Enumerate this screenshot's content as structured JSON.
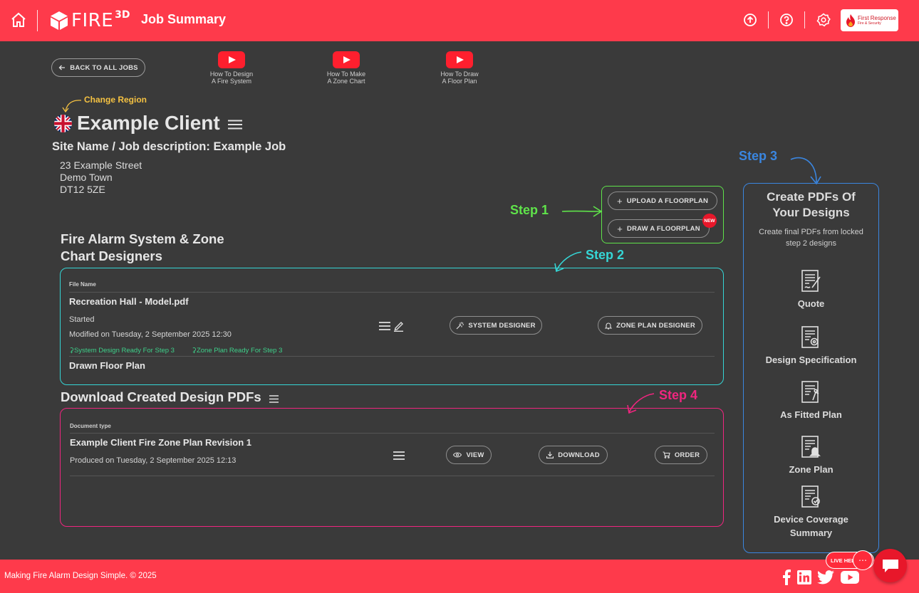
{
  "header": {
    "logo_text": "FIRE",
    "logo_sup": "3D",
    "title": "Job Summary",
    "brand_name": "First Response",
    "brand_sub": "Fire & Security"
  },
  "nav": {
    "back_label": "BACK TO ALL JOBS",
    "videos": [
      {
        "line1": "How To Design",
        "line2": "A Fire System"
      },
      {
        "line1": "How To Make",
        "line2": "A Zone Chart"
      },
      {
        "line1": "How To Draw",
        "line2": "A Floor Plan"
      }
    ]
  },
  "client": {
    "change_region": "Change Region",
    "name": "Example Client",
    "site_name": "Site Name / Job description: Example Job",
    "address": [
      "23 Example Street",
      "Demo Town",
      "DT12 5ZE"
    ]
  },
  "steps": {
    "step1": "Step 1",
    "step2": "Step 2",
    "step3": "Step 3",
    "step4": "Step 4"
  },
  "floorplan": {
    "upload_label": "UPLOAD A FLOORPLAN",
    "draw_label": "DRAW A FLOORPLAN",
    "new_badge": "NEW"
  },
  "designers": {
    "title_line1": "Fire Alarm System & Zone",
    "title_line2": "Chart Designers",
    "col_file_name": "File Name",
    "file_name": "Recreation Hall - Model.pdf",
    "status": "Started",
    "modified": "Modified on Tuesday, 2 September 2025 12:30",
    "ready_system": "System Design Ready For Step 3",
    "ready_zone": "Zone Plan Ready For Step 3",
    "system_designer_label": "SYSTEM DESIGNER",
    "zone_plan_designer_label": "ZONE PLAN DESIGNER",
    "drawn_floor_plan": "Drawn Floor Plan"
  },
  "downloads": {
    "title": "Download Created Design PDFs",
    "col_doc_type": "Document type",
    "doc_name": "Example Client Fire Zone Plan Revision 1",
    "produced": "Produced on Tuesday, 2 September 2025 12:13",
    "view_label": "VIEW",
    "download_label": "DOWNLOAD",
    "order_label": "ORDER"
  },
  "sidebar": {
    "title_line1": "Create PDFs Of",
    "title_line2": "Your Designs",
    "sub_line1": "Create final PDFs from locked",
    "sub_line2": "step 2 designs",
    "items": [
      {
        "label": "Quote",
        "icon": "quote-doc-icon"
      },
      {
        "label": "Design Specification",
        "icon": "design-spec-doc-icon"
      },
      {
        "label": "As Fitted Plan",
        "icon": "as-fitted-doc-icon"
      },
      {
        "label": "Zone Plan",
        "icon": "zone-plan-doc-icon"
      },
      {
        "label_line1": "Device Coverage",
        "label_line2": "Summary",
        "icon": "coverage-doc-icon"
      }
    ]
  },
  "footer": {
    "text": "Making Fire Alarm Design Simple. © 2025",
    "live_help": "LIVE HELP"
  },
  "colors": {
    "accent": "#fe3a4b",
    "step1": "#5fe34a",
    "step2": "#35d6d6",
    "step3": "#3a86e0",
    "step4": "#f0257f",
    "region": "#f5c242",
    "ready": "#3ed08a"
  }
}
